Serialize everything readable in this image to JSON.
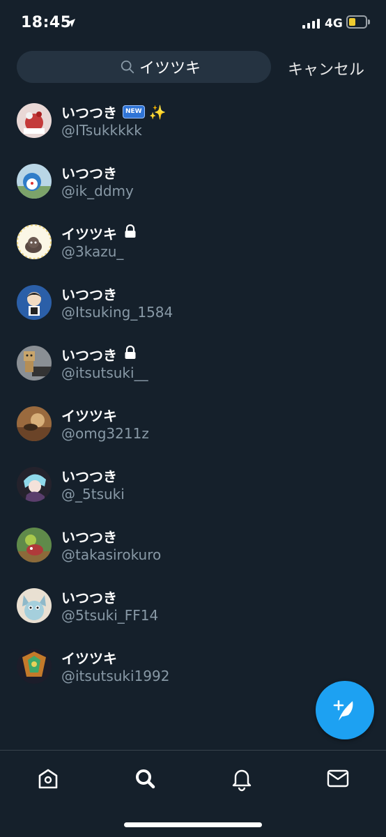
{
  "status_bar": {
    "time": "18:45",
    "network": "4G",
    "battery_color": "#f0cc30"
  },
  "search": {
    "query": "イツツキ",
    "cancel_label": "キャンセル"
  },
  "results": [
    {
      "name": "いつつき",
      "handle": "@ITsukkkkk",
      "badges": [
        "NEW",
        "✨"
      ],
      "locked": false
    },
    {
      "name": "いつつき",
      "handle": "@ik_ddmy",
      "badges": [],
      "locked": false
    },
    {
      "name": "イツツキ",
      "handle": "@3kazu_",
      "badges": [],
      "locked": true
    },
    {
      "name": "いつつき",
      "handle": "@Itsuking_1584",
      "badges": [],
      "locked": false
    },
    {
      "name": "いつつき",
      "handle": "@itsutsuki__",
      "badges": [],
      "locked": true
    },
    {
      "name": "イツツキ",
      "handle": "@omg3211z",
      "badges": [],
      "locked": false
    },
    {
      "name": "いつつき",
      "handle": "@_5tsuki",
      "badges": [],
      "locked": false
    },
    {
      "name": "いつつき",
      "handle": "@takasirokuro",
      "badges": [],
      "locked": false
    },
    {
      "name": "いつつき",
      "handle": "@5tsuki_FF14",
      "badges": [],
      "locked": false
    },
    {
      "name": "イツツキ",
      "handle": "@itsutsuki1992",
      "badges": [],
      "locked": false
    }
  ],
  "fab": {
    "icon": "compose-tweet-icon",
    "color": "#1da1f2"
  },
  "tabbar": {
    "tabs": [
      "home-icon",
      "search-icon",
      "notifications-icon",
      "messages-icon"
    ],
    "active": "search-icon"
  },
  "colors": {
    "background": "#15202b",
    "secondary_text": "#8899a6",
    "accent": "#1da1f2"
  }
}
